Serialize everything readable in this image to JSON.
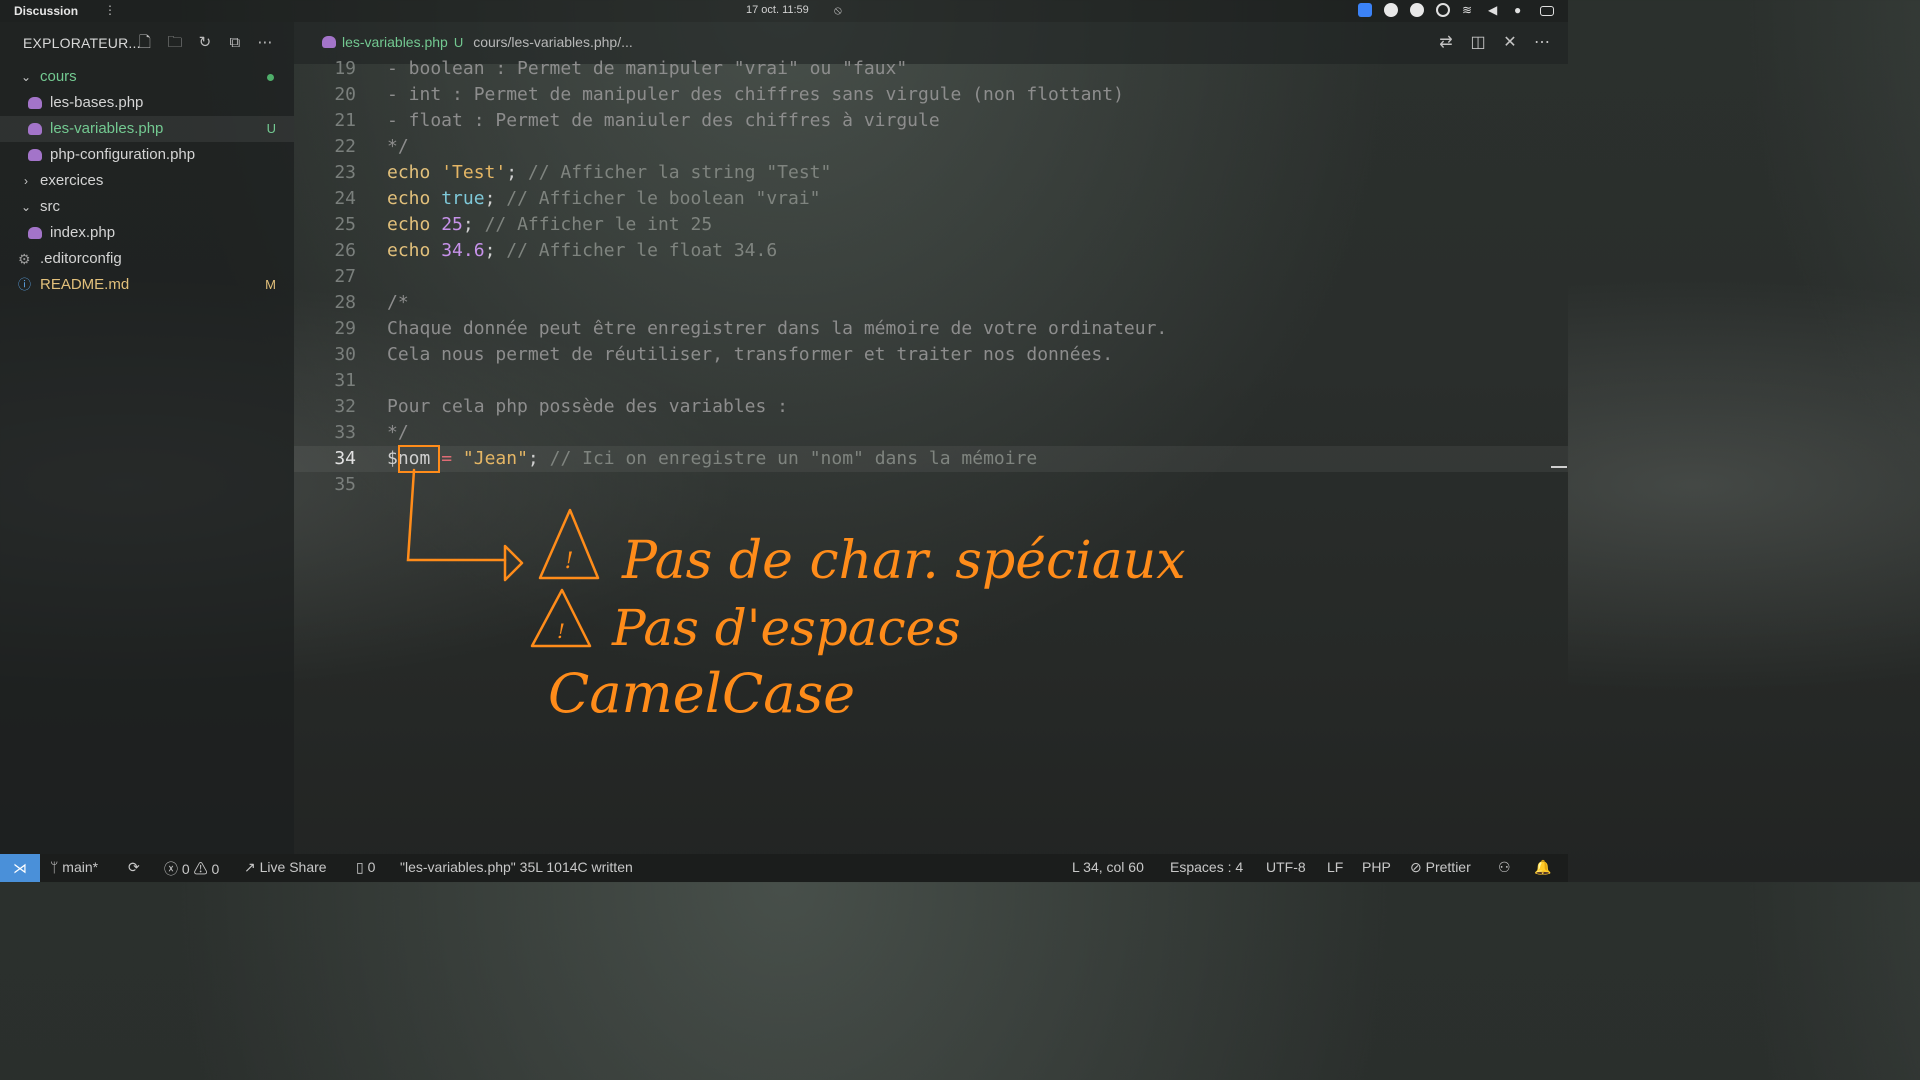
{
  "topbar": {
    "app_name": "Discussion",
    "clock": "17 oct.  11:59"
  },
  "sidebar": {
    "title": "EXPLORATEUR...",
    "items": [
      {
        "label": "cours",
        "badge": ""
      },
      {
        "label": "les-bases.php",
        "badge": ""
      },
      {
        "label": "les-variables.php",
        "badge": "U"
      },
      {
        "label": "php-configuration.php",
        "badge": ""
      },
      {
        "label": "exercices",
        "badge": ""
      },
      {
        "label": "src",
        "badge": ""
      },
      {
        "label": "index.php",
        "badge": ""
      },
      {
        "label": ".editorconfig",
        "badge": ""
      },
      {
        "label": "README.md",
        "badge": "M"
      }
    ]
  },
  "tab": {
    "name": "les-variables.php",
    "status": "U",
    "path": "cours/les-variables.php/..."
  },
  "code": {
    "lines": [
      {
        "n": "19",
        "text": "- boolean : Permet de manipuler \"vrai\" ou \"faux\""
      },
      {
        "n": "20",
        "text": "- int : Permet de manipuler des chiffres sans virgule (non flottant)"
      },
      {
        "n": "21",
        "text": "- float : Permet de maniuler des chiffres à virgule"
      },
      {
        "n": "22",
        "text": "*/"
      },
      {
        "n": "23",
        "kw": "echo",
        "val": "'Test'",
        "comment": "// Afficher la string \"Test\""
      },
      {
        "n": "24",
        "kw": "echo",
        "val": "true",
        "comment": "// Afficher le boolean \"vrai\""
      },
      {
        "n": "25",
        "kw": "echo",
        "val": "25",
        "comment": "// Afficher le int 25"
      },
      {
        "n": "26",
        "kw": "echo",
        "val": "34.6",
        "comment": "// Afficher le float 34.6"
      },
      {
        "n": "27",
        "text": ""
      },
      {
        "n": "28",
        "text": "/*"
      },
      {
        "n": "29",
        "text": "Chaque donnée peut être enregistrer dans la mémoire de votre ordinateur."
      },
      {
        "n": "30",
        "text": "Cela nous permet de réutiliser, transformer et traiter nos données."
      },
      {
        "n": "31",
        "text": ""
      },
      {
        "n": "32",
        "text": "Pour cela php possède des variables :"
      },
      {
        "n": "33",
        "text": "*/"
      },
      {
        "n": "34",
        "var": "$nom",
        "op": "=",
        "str": "\"Jean\"",
        "comment": "// Ici on enregistre un \"nom\" dans la mémoire"
      },
      {
        "n": "35",
        "text": ""
      }
    ]
  },
  "annotations": {
    "line1": "Pas de char. spéciaux",
    "line2": "Pas d'espaces",
    "line3": "CamelCase",
    "color": "#ff8c1a"
  },
  "statusbar": {
    "branch": "main*",
    "errors": "0",
    "warnings": "0",
    "live_share": "Live Share",
    "ports": "0",
    "message": "\"les-variables.php\" 35L 1014C written",
    "position": "L 34, col 60",
    "spaces": "Espaces : 4",
    "encoding": "UTF-8",
    "eol": "LF",
    "language": "PHP",
    "formatter": "Prettier"
  },
  "colors": {
    "accent": "#4a90d9",
    "git_untracked": "#73c991",
    "keyword": "#e2c07b",
    "annotation": "#ff8c1a"
  }
}
